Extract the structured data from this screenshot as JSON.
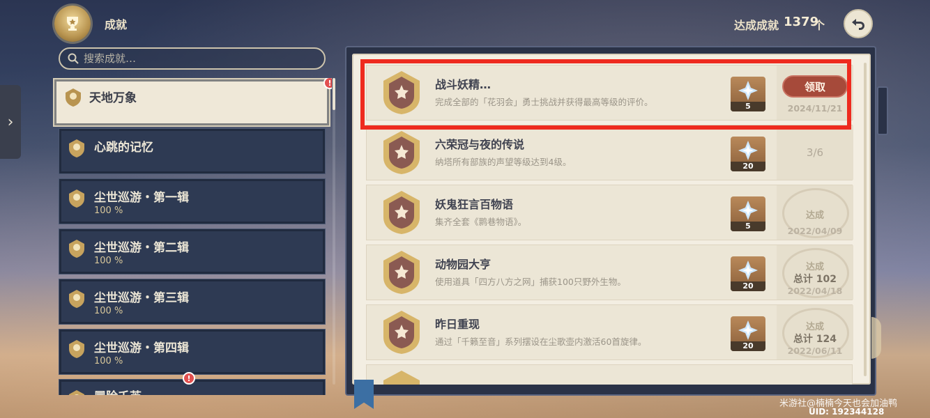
{
  "header": {
    "title": "成就",
    "count_label": "达成成就",
    "count_value": "1379",
    "count_unit": "个"
  },
  "search": {
    "placeholder": "搜索成就…"
  },
  "categories": [
    {
      "name": "天地万象",
      "pct": "",
      "selected": true,
      "alert": "!"
    },
    {
      "name": "心跳的记忆",
      "pct": ""
    },
    {
      "name": "尘世巡游・第一辑",
      "pct": "100 %"
    },
    {
      "name": "尘世巡游・第二辑",
      "pct": "100 %"
    },
    {
      "name": "尘世巡游・第三辑",
      "pct": "100 %"
    },
    {
      "name": "尘世巡游・第四辑",
      "pct": "100 %"
    },
    {
      "name": "冒险壬芙",
      "pct": "",
      "alert": "!"
    }
  ],
  "achievements": [
    {
      "title": "战斗妖精…",
      "desc": "完成全部的「花羽会」勇士挑战并获得最高等级的评价。",
      "reward_qty": "5",
      "status": "claim",
      "claim_label": "领取",
      "date": "2024/11/21"
    },
    {
      "title": "六荣冠与夜的传说",
      "desc": "纳塔所有部族的声望等级达到4级。",
      "reward_qty": "20",
      "status": "progress",
      "progress": "3/6"
    },
    {
      "title": "妖鬼狂言百物语",
      "desc": "集齐全套《鹮巷物语》。",
      "reward_qty": "5",
      "status": "done",
      "stamp_label": "达成",
      "date": "2022/04/09"
    },
    {
      "title": "动物园大亨",
      "desc": "使用道具「四方八方之网」捕获100只野外生物。",
      "reward_qty": "20",
      "status": "done",
      "stamp_label": "达成",
      "total": "总计 102",
      "date": "2022/04/18"
    },
    {
      "title": "昨日重现",
      "desc": "通过「千籁至音」系列摆设在尘歌壶内激活60首旋律。",
      "reward_qty": "20",
      "status": "done",
      "stamp_label": "达成",
      "total": "总计 124",
      "date": "2022/06/11"
    }
  ],
  "footer": {
    "watermark": "米游社@楠楠今天也会加油鸭",
    "uid": "UID: 192344128"
  },
  "colors": {
    "highlight": "#ee2b1f",
    "claim_button": "#a64a3a",
    "panel_dark": "#2e3a53",
    "page_light": "#f3eee2"
  },
  "icons": [
    "trophy-emblem-icon",
    "back-arrow-icon",
    "chevron-right-icon",
    "search-icon",
    "category-badge-icon",
    "achievement-badge-icon",
    "primogem-icon"
  ]
}
